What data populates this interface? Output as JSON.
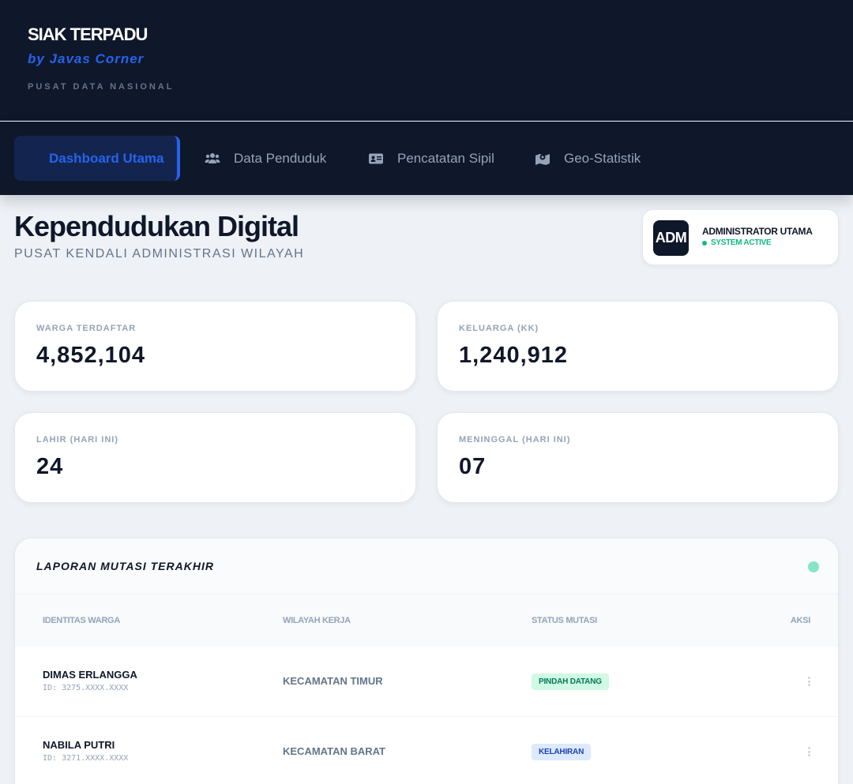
{
  "brand": {
    "title": "SIAK TERPADU",
    "subtitle": "by Javas Corner",
    "tagline": "PUSAT DATA NASIONAL"
  },
  "nav": {
    "items": [
      {
        "label": "Dashboard Utama",
        "icon": "dashboard-icon",
        "active": true
      },
      {
        "label": "Data Penduduk",
        "icon": "users-icon",
        "active": false
      },
      {
        "label": "Pencatatan Sipil",
        "icon": "id-card-icon",
        "active": false
      },
      {
        "label": "Geo-Statistik",
        "icon": "map-marker-icon",
        "active": false
      }
    ]
  },
  "page": {
    "title": "Kependudukan Digital",
    "subtitle": "PUSAT KENDALI ADMINISTRASI WILAYAH"
  },
  "admin": {
    "avatar": "ADM",
    "name": "ADMINISTRATOR UTAMA",
    "status": "SYSTEM ACTIVE"
  },
  "stats": [
    {
      "label": "WARGA TERDAFTAR",
      "value": "4,852,104"
    },
    {
      "label": "KELUARGA (KK)",
      "value": "1,240,912"
    },
    {
      "label": "LAHIR (HARI INI)",
      "value": "24"
    },
    {
      "label": "MENINGGAL (HARI INI)",
      "value": "07"
    }
  ],
  "report": {
    "title": "LAPORAN MUTASI TERAKHIR",
    "columns": [
      "IDENTITAS WARGA",
      "WILAYAH KERJA",
      "STATUS MUTASI",
      "AKSI"
    ],
    "rows": [
      {
        "name": "DIMAS ERLANGGA",
        "id": "ID: 3275.XXXX.XXXX",
        "region": "KECAMATAN TIMUR",
        "status": "PINDAH DATANG",
        "status_color": "#047857"
      },
      {
        "name": "NABILA PUTRI",
        "id": "ID: 3271.XXXX.XXXX",
        "region": "KECAMATAN BARAT",
        "status": "KELAHIRAN",
        "status_color": "#1e40af"
      }
    ]
  },
  "colors": {
    "navy": "#0f172a",
    "accent": "#2563eb",
    "success": "#10b981"
  }
}
